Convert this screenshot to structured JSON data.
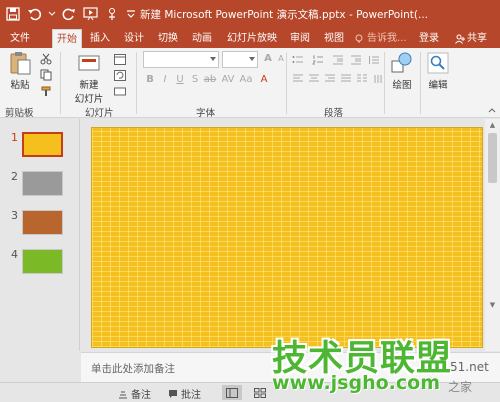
{
  "window": {
    "title": "新建 Microsoft PowerPoint 演示文稿.pptx - PowerPoint(..."
  },
  "tabs": [
    {
      "label": "文件"
    },
    {
      "label": "开始"
    },
    {
      "label": "插入"
    },
    {
      "label": "设计"
    },
    {
      "label": "切换"
    },
    {
      "label": "动画"
    },
    {
      "label": "幻灯片放映"
    },
    {
      "label": "审阅"
    },
    {
      "label": "视图"
    }
  ],
  "tell_me": {
    "label": "告诉我..."
  },
  "account": {
    "login": "登录",
    "share": "共享"
  },
  "ribbon": {
    "paste_label": "粘贴",
    "new_slide_label_1": "新建",
    "new_slide_label_2": "幻灯片",
    "draw_label": "绘图",
    "edit_label": "编辑",
    "groups": {
      "clipboard": "剪贴板",
      "slides": "幻灯片",
      "font": "字体",
      "paragraph": "段落"
    }
  },
  "slides": [
    {
      "number": "1",
      "color": "#f5bf1e",
      "selected": true
    },
    {
      "number": "2",
      "color": "#9a9a9a",
      "selected": false
    },
    {
      "number": "3",
      "color": "#b8652e",
      "selected": false
    },
    {
      "number": "4",
      "color": "#7cb926",
      "selected": false
    }
  ],
  "notes": {
    "placeholder": "单击此处添加备注"
  },
  "statusbar": {
    "notes_label": "备注",
    "comments_label": "批注"
  },
  "watermark": {
    "brand": "技术员联盟",
    "url": "www.jsgho.com",
    "side_1": "51.net",
    "side_2": "之家"
  },
  "colors": {
    "accent": "#b7472a",
    "slide_fill": "#f5bf1e",
    "watermark_green": "#4db733"
  }
}
